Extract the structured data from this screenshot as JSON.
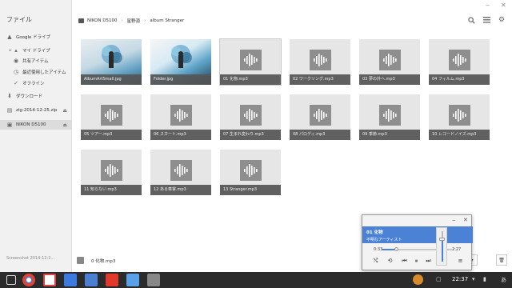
{
  "app": {
    "title": "ファイル"
  },
  "sidebar": {
    "items": [
      {
        "label": "Google ドライブ",
        "icon": "drive-icon"
      },
      {
        "label": "マイ ドライブ",
        "icon": "my-drive-icon"
      },
      {
        "label": "共有アイテム",
        "icon": "shared-icon"
      },
      {
        "label": "最近使用したアイテム",
        "icon": "recent-icon"
      },
      {
        "label": "オフライン",
        "icon": "offline-icon"
      },
      {
        "label": "ダウンロード",
        "icon": "download-icon"
      },
      {
        "label": "zig-2014-12-25.zip",
        "icon": "archive-icon"
      },
      {
        "label": "NIKON D5100",
        "icon": "camera-icon"
      }
    ],
    "footer": "Screenshot 2014-12-2..."
  },
  "breadcrumb": [
    "NIKON D5100",
    "星野源",
    "album Stranger"
  ],
  "files": [
    {
      "name": "AlbumArtSmall.jpg",
      "kind": "image"
    },
    {
      "name": "Folder.jpg",
      "kind": "image"
    },
    {
      "name": "01 化物.mp3",
      "kind": "audio"
    },
    {
      "name": "02 ワークソング.mp3",
      "kind": "audio"
    },
    {
      "name": "03 夢の外へ.mp3",
      "kind": "audio"
    },
    {
      "name": "04 フィルム.mp3",
      "kind": "audio"
    },
    {
      "name": "05 ツアー.mp3",
      "kind": "audio"
    },
    {
      "name": "06 スカート.mp3",
      "kind": "audio"
    },
    {
      "name": "07 生まれ変わり.mp3",
      "kind": "audio"
    },
    {
      "name": "08 パロディ.mp3",
      "kind": "audio"
    },
    {
      "name": "09 季節.mp3",
      "kind": "audio"
    },
    {
      "name": "10 レコードノイズ.mp3",
      "kind": "audio"
    },
    {
      "name": "11 知らない.mp3",
      "kind": "audio"
    },
    {
      "name": "12 ある車掌.mp3",
      "kind": "audio"
    },
    {
      "name": "13 Stranger.mp3",
      "kind": "audio"
    }
  ],
  "status": {
    "text": "0 化物.mp3"
  },
  "player": {
    "title": "01 化物",
    "artist": "不明なアーティスト",
    "elapsed": "0:33",
    "duration": "2:27",
    "progress_fraction": 0.22,
    "volume_fraction": 0.75
  },
  "shelf": {
    "time": "22:37",
    "ime": "あ",
    "colors": {
      "accent": "#4c82d6",
      "shelf_bg": "#2b2b2b"
    }
  }
}
